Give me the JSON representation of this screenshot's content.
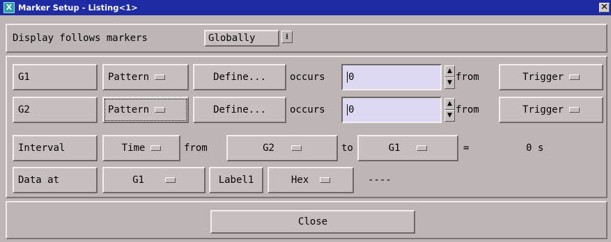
{
  "window": {
    "title": "Marker Setup - Listing<1>",
    "icon_letter": "X",
    "close_glyph": "✕"
  },
  "display_follows": {
    "label": "Display follows markers",
    "value": "Globally"
  },
  "rows": {
    "g1": {
      "name": "G1",
      "mode": "Pattern",
      "define": "Define...",
      "occurs_label": "occurs",
      "occurs_value": "0",
      "from_label": "from",
      "from_value": "Trigger"
    },
    "g2": {
      "name": "G2",
      "mode": "Pattern",
      "define": "Define...",
      "occurs_label": "occurs",
      "occurs_value": "0",
      "from_label": "from",
      "from_value": "Trigger"
    },
    "interval": {
      "name": "Interval",
      "mode": "Time",
      "from_label": "from",
      "from_value": "G2",
      "to_label": "to",
      "to_value": "G1",
      "equals": "=",
      "result": "0 s"
    },
    "data_at": {
      "name": "Data at",
      "marker": "G1",
      "label": "Label1",
      "base": "Hex",
      "value": "----"
    }
  },
  "footer": {
    "close_label": "Close"
  },
  "colors": {
    "titlebar": "#1f2ba3",
    "background": "#bdb6b5",
    "field": "#ddd9f2"
  }
}
